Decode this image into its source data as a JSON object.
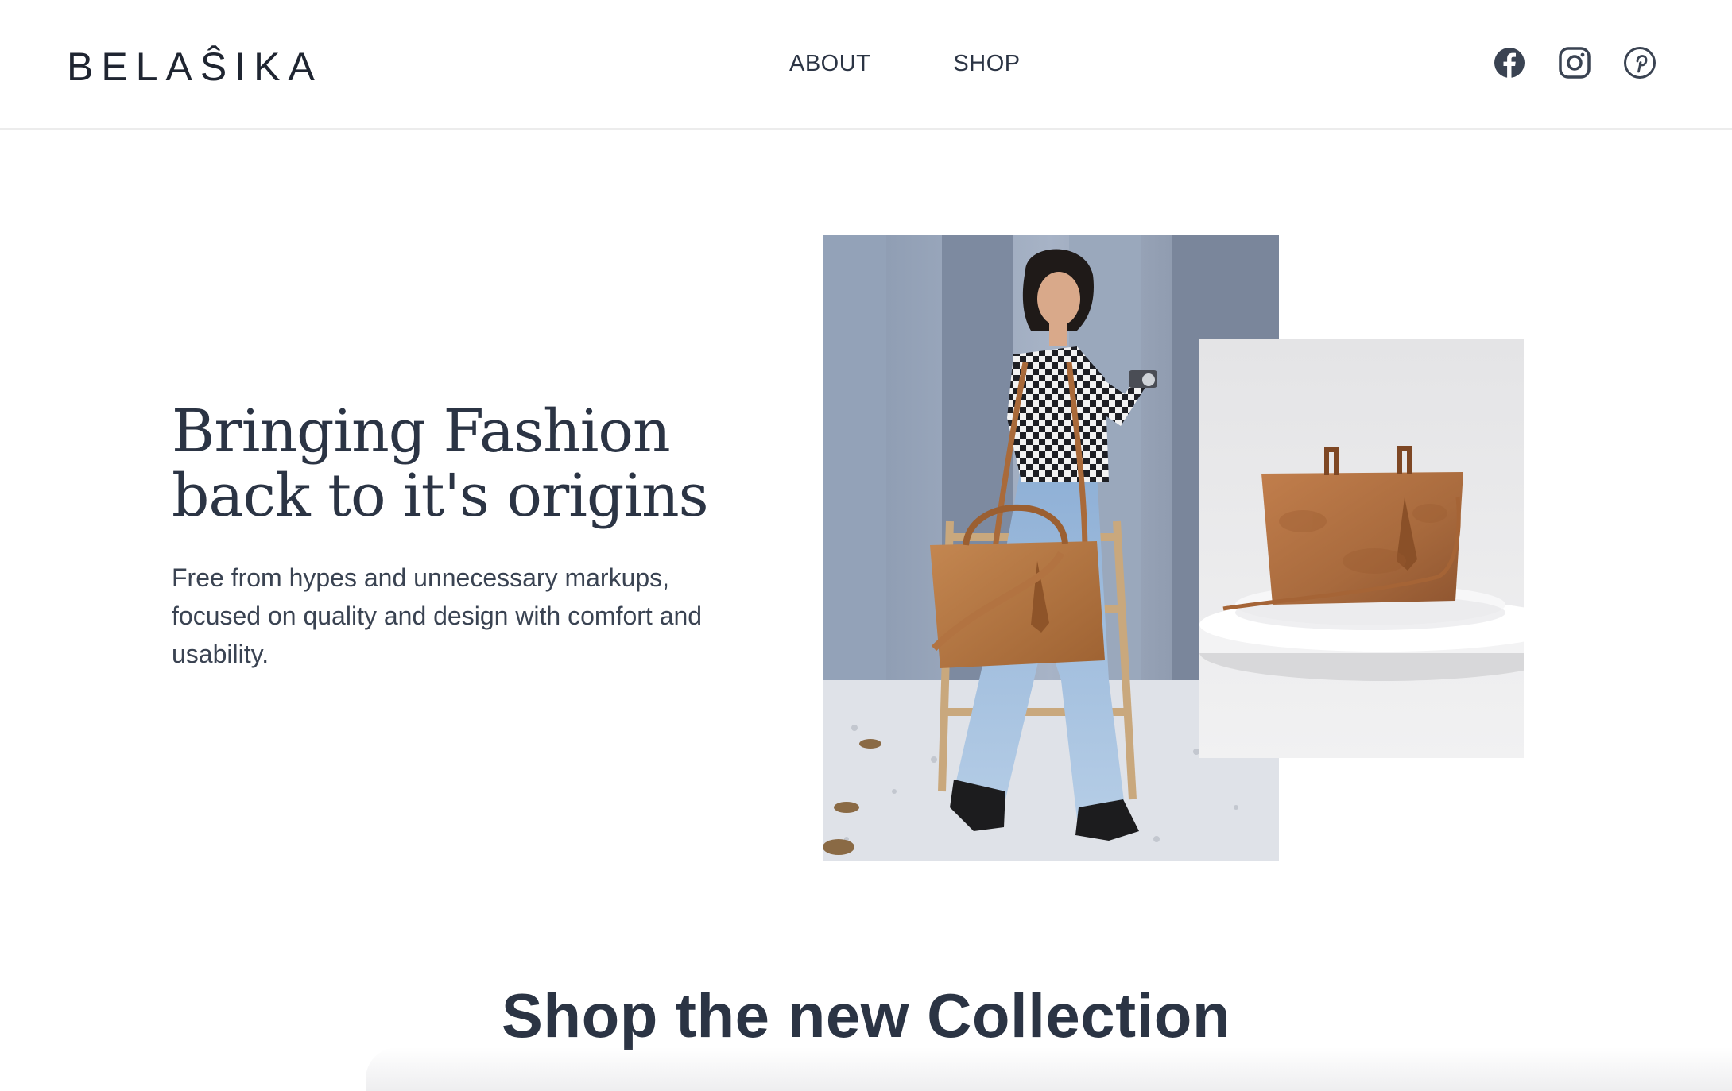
{
  "header": {
    "logo": "BELAŜIKA",
    "nav": [
      {
        "label": "ABOUT"
      },
      {
        "label": "SHOP"
      }
    ],
    "social": [
      "facebook-icon",
      "instagram-icon",
      "pinterest-icon"
    ]
  },
  "hero": {
    "title_line1": "Bringing Fashion",
    "title_line2": "back to it's origins",
    "subtitle": "Free from hypes and unnecessary markups, focused on quality and design with comfort and usability."
  },
  "section": {
    "title": "Shop the new Collection"
  },
  "colors": {
    "text": "#2b3444",
    "divider": "#ececec",
    "leather": "#b8743f",
    "wall": "#8f9cb2"
  }
}
